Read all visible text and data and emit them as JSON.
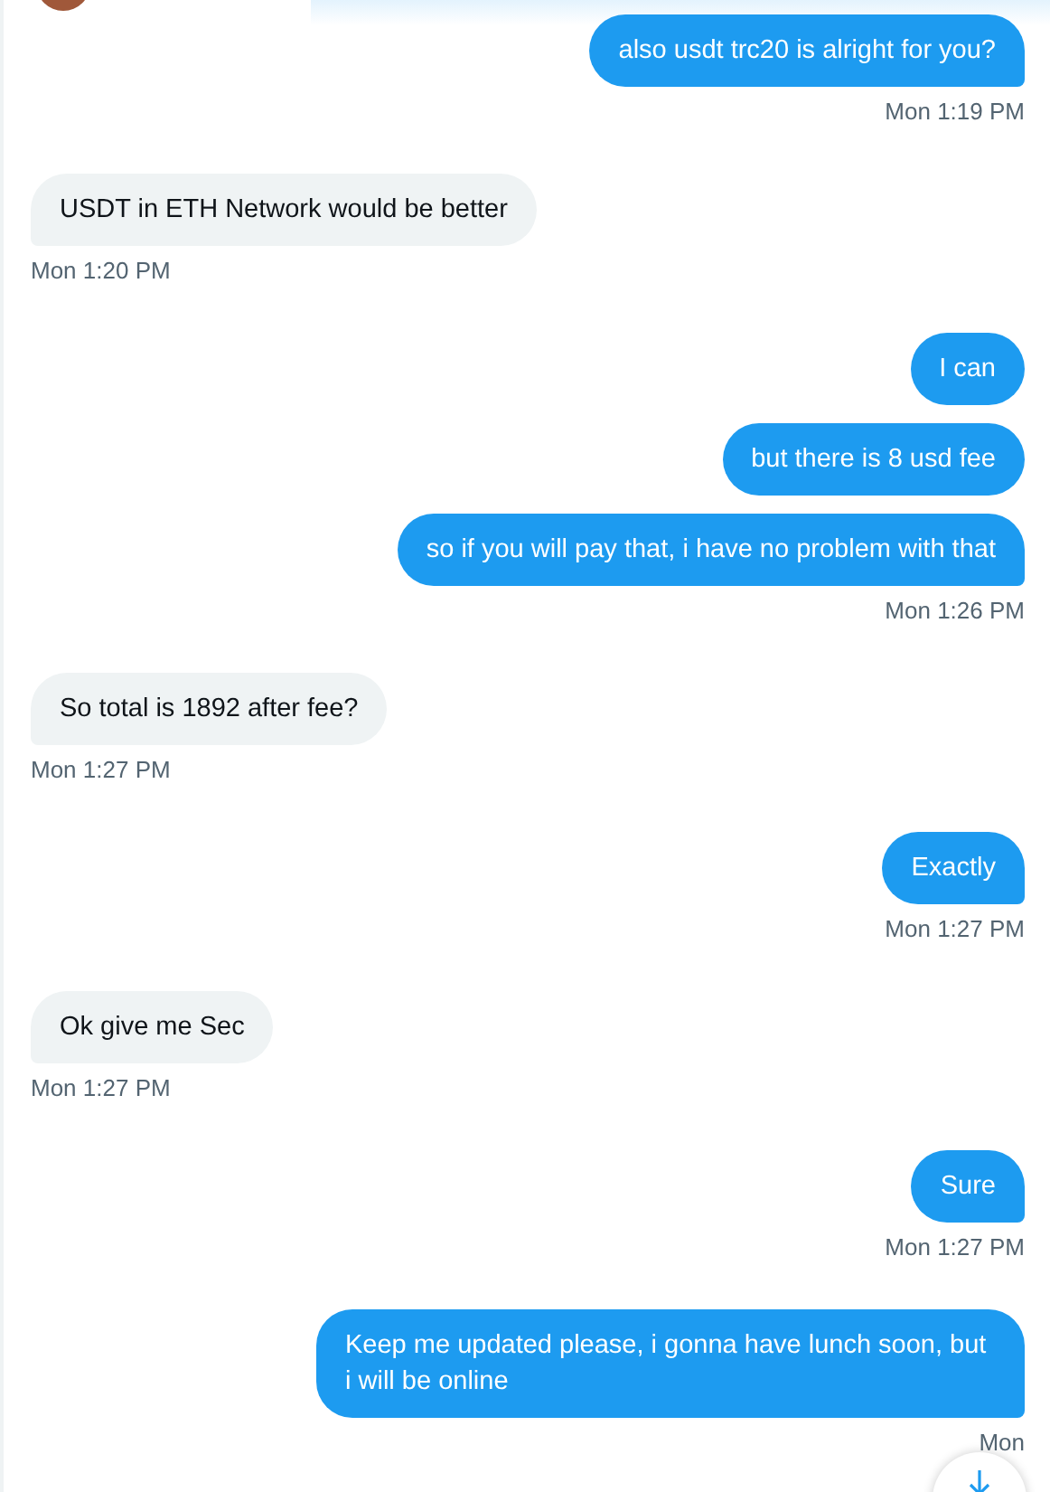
{
  "groups": [
    {
      "kind": "sent",
      "messages": [
        "also usdt trc20 is alright for you?"
      ],
      "time": "Mon 1:19 PM"
    },
    {
      "kind": "received",
      "messages": [
        "USDT in ETH Network would be better"
      ],
      "time": "Mon 1:20 PM"
    },
    {
      "kind": "sent",
      "messages": [
        "I can",
        "but there is 8 usd fee",
        "so if you will pay that, i have no problem with that"
      ],
      "time": "Mon 1:26 PM"
    },
    {
      "kind": "received",
      "messages": [
        "So total is 1892 after fee?"
      ],
      "time": "Mon 1:27 PM"
    },
    {
      "kind": "sent",
      "messages": [
        "Exactly"
      ],
      "time": "Mon 1:27 PM"
    },
    {
      "kind": "received",
      "messages": [
        "Ok give me Sec"
      ],
      "time": "Mon 1:27 PM"
    },
    {
      "kind": "sent",
      "messages": [
        "Sure"
      ],
      "time": "Mon 1:27 PM"
    },
    {
      "kind": "sent",
      "messages": [
        "Keep me updated please, i gonna have lunch soon, but i will be online"
      ],
      "time": "Mon"
    }
  ]
}
